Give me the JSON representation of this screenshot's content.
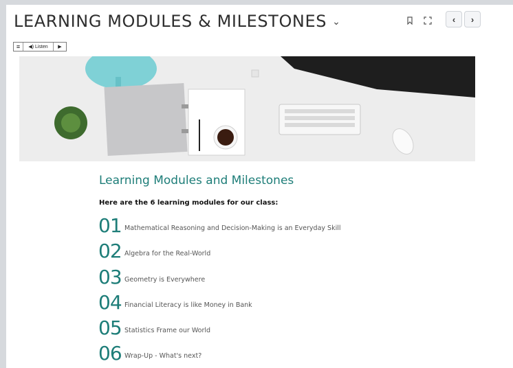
{
  "header": {
    "title": "LEARNING MODULES & MILESTONES",
    "chevron": "⌄",
    "tools": {
      "bookmark_icon": "bookmark-icon",
      "fullscreen_icon": "fullscreen-icon"
    },
    "nav": {
      "prev": "‹",
      "next": "›"
    }
  },
  "listen_bar": {
    "menu_icon": "≡",
    "label": "◀) Listen",
    "play": "▶"
  },
  "content": {
    "heading": "Learning Modules and Milestones",
    "intro": "Here are the 6 learning modules for our class:",
    "modules": [
      {
        "num": "01",
        "title": "Mathematical Reasoning and Decision-Making is an Everyday Skill"
      },
      {
        "num": "02",
        "title": "Algebra for the Real-World"
      },
      {
        "num": "03",
        "title": "Geometry is Everywhere"
      },
      {
        "num": "04",
        "title": "Financial Literacy is like Money in Bank"
      },
      {
        "num": "05",
        "title": "Statistics Frame our World"
      },
      {
        "num": "06",
        "title": "Wrap-Up - What's next?"
      }
    ]
  },
  "colors": {
    "accent": "#1d7d78",
    "page_bg": "#d6d9dd"
  }
}
